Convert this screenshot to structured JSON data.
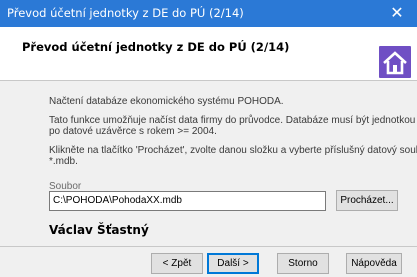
{
  "window": {
    "title": "Převod účetní jednotky z DE do PÚ (2/14)",
    "close_glyph": "✕"
  },
  "header": {
    "title": "Převod účetní jednotky z DE do PÚ (2/14)",
    "icon": "home-icon"
  },
  "body": {
    "line1": "Načtení databáze ekonomického systému POHODA.",
    "line2a": "Tato funkce umožňuje načíst data firmy do průvodce. Databáze musí být jednotkou DE",
    "line2b": "po datové uzávěrce s rokem >= 2004.",
    "line3a": "Klikněte na tlačítko 'Procházet', zvolte danou složku a vyberte příslušný datový soubor",
    "line3b": "*.mdb.",
    "file_label": "Soubor",
    "file_value": "C:\\POHODA\\PohodaXX.mdb",
    "browse_label": "Procházet...",
    "signature": "Václav Šťastný"
  },
  "footer": {
    "back_label": "< Zpět",
    "next_label": "Další >",
    "cancel_label": "Storno",
    "help_label": "Nápověda"
  },
  "colors": {
    "titlebar": "#2b79d6",
    "accent": "#0078d7",
    "home_icon": "#6f4fc4"
  }
}
